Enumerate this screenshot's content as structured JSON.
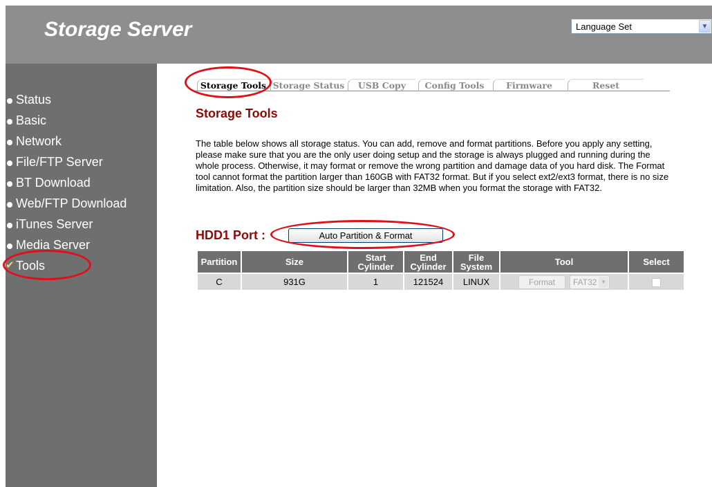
{
  "header": {
    "title": "Storage Server",
    "language_select": {
      "value": "Language Set"
    }
  },
  "sidebar": {
    "items": [
      {
        "label": "Status"
      },
      {
        "label": "Basic"
      },
      {
        "label": "Network"
      },
      {
        "label": "File/FTP Server"
      },
      {
        "label": "BT Download"
      },
      {
        "label": "Web/FTP Download"
      },
      {
        "label": "iTunes Server"
      },
      {
        "label": "Media Server"
      },
      {
        "label": "Tools",
        "active": true
      }
    ]
  },
  "tabs": [
    {
      "label": "Storage Tools",
      "active": true
    },
    {
      "label": "Storage Status"
    },
    {
      "label": "USB Copy"
    },
    {
      "label": "Config Tools"
    },
    {
      "label": "Firmware"
    },
    {
      "label": "Reset"
    }
  ],
  "main": {
    "title": "Storage Tools",
    "intro": "The table below shows all storage status. You can add, remove and format partitions. Before you apply any setting, please make sure that you are the only user doing setup and the storage is always plugged and running during the whole process. Otherwise, it may format or remove the wrong partition and damage data of you hard disk. The Format tool cannot format the partition larger than 160GB with FAT32 format. But if you select ext2/ext3 format, there is no size limitation. Also, the partition size should be larger than 32MB when you format the storage with FAT32.",
    "hdd_title": "HDD1 Port :",
    "auto_button": "Auto Partition & Format"
  },
  "table": {
    "headers": {
      "partition": "Partition",
      "size": "Size",
      "start": "Start Cylinder",
      "end": "End Cylinder",
      "fs": "File System",
      "tool": "Tool",
      "select": "Select"
    },
    "rows": [
      {
        "partition": "C",
        "size": "931G",
        "start": "1",
        "end": "121524",
        "fs": "LINUX",
        "format_label": "Format",
        "format_type": "FAT32",
        "selected": false
      }
    ]
  },
  "colors": {
    "header_bg": "#8e8e8e",
    "sidebar_bg": "#6f6f6f",
    "title_red": "#8b0a0a",
    "highlight": "#e0101a"
  }
}
